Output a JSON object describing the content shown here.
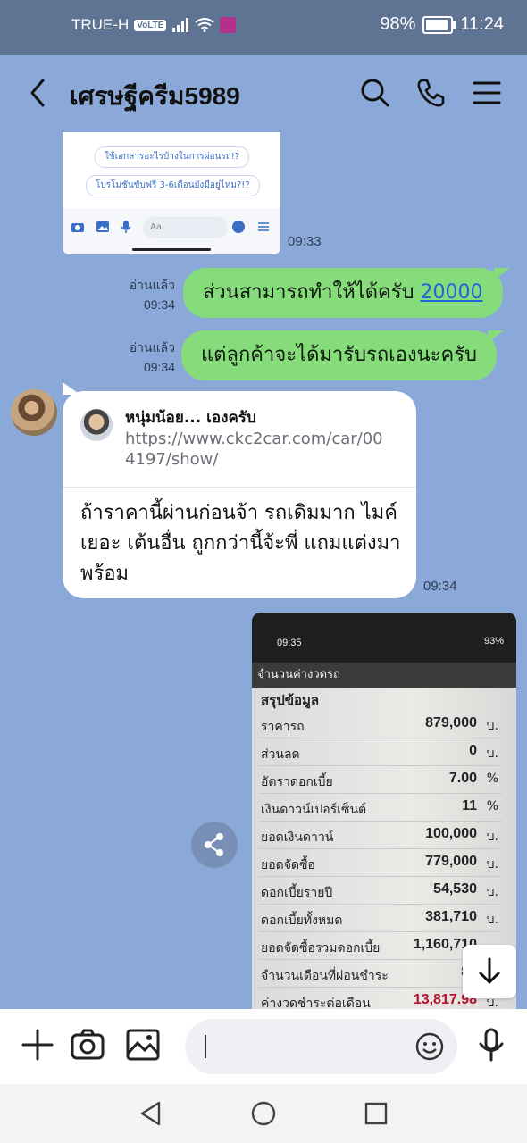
{
  "status_bar": {
    "carrier": "TRUE-H",
    "volte": "VoLTE",
    "battery": "98%",
    "battery_level": 0.98,
    "time": "11:24"
  },
  "header": {
    "title": "เศรษฐีครีม5989"
  },
  "messages": {
    "image_card": {
      "pill1": "ใช้เอกสารอะไรบ้างในการผ่อนรถ!?",
      "pill2": "โปรโมชั่นขับฟรี 3-6เดือนยังมีอยู่ไหม?!?",
      "input_placeholder": "Aa",
      "time": "09:33"
    },
    "sent1": {
      "read": "อ่านแล้ว",
      "time": "09:34",
      "text": "ส่วนสามารถทำให้ได้ครับ",
      "link": "20000"
    },
    "sent2": {
      "read": "อ่านแล้ว",
      "time": "09:34",
      "text": "แต่ลูกค้าจะได้มารับรถเองนะครับ"
    },
    "received": {
      "reply_name": "หนุ่มน้อย... เองครับ",
      "reply_link": "https://www.ckc2car.com/car/004197/show/",
      "text": "ถ้าราคานี้ผ่านก่อนจ้า รถเดิมมาก ไมค์เยอะ เต้นอื่น ถูกกว่านี้จ้ะพี่ แถมแต่งมาพร้อม",
      "time": "09:34"
    },
    "screenshot": {
      "status_time": "09:35",
      "status_right": "93%",
      "app_title": "จำนวนค่างวดรถ",
      "heading": "สรุปข้อมูล",
      "rows": [
        {
          "label": "ราคารถ",
          "value": "879,000",
          "unit": "บ."
        },
        {
          "label": "ส่วนลด",
          "value": "0",
          "unit": "บ."
        },
        {
          "label": "อัตราดอกเบี้ย",
          "value": "7.00",
          "unit": "%"
        },
        {
          "label": "เงินดาวน์เปอร์เซ็นต์",
          "value": "11",
          "unit": "%"
        },
        {
          "label": "ยอดเงินดาวน์",
          "value": "100,000",
          "unit": "บ."
        },
        {
          "label": "ยอดจัดซื้อ",
          "value": "779,000",
          "unit": "บ."
        },
        {
          "label": "ดอกเบี้ยรายปี",
          "value": "54,530",
          "unit": "บ."
        },
        {
          "label": "ดอกเบี้ยทั้งหมด",
          "value": "381,710",
          "unit": "บ."
        },
        {
          "label": "ยอดจัดซื้อรวมดอกเบี้ย",
          "value": "1,160,710",
          "unit": ""
        },
        {
          "label": "จำนวนเดือนที่ผ่อนชำระ",
          "value": "84",
          "unit": ""
        },
        {
          "label": "ค่างวดชำระต่อเดือน",
          "value": "13,817.98",
          "unit": "บ."
        }
      ]
    }
  },
  "colors": {
    "chat_background": "#8ba9d8",
    "sent_bubble": "#86dc7a",
    "link": "#1f64d8"
  }
}
